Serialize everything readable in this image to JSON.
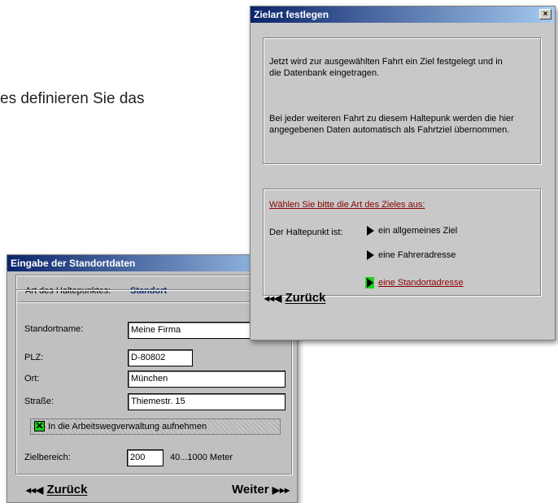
{
  "background_text": "es definieren Sie das",
  "standort_dialog": {
    "title": "Eingabe der Standortdaten",
    "type_label": "Art des Haltepunktes:",
    "type_value": "Standort",
    "name_label": "Standortname:",
    "name_value": "Meine Firma",
    "plz_label": "PLZ:",
    "plz_value": "D-80802",
    "ort_label": "Ort:",
    "ort_value": "München",
    "strasse_label": "Straße:",
    "strasse_value": "Thiemestr. 15",
    "checkbox_label": "In die Arbeitswegverwaltung aufnehmen",
    "checkbox_checked": true,
    "zielbereich_label": "Zielbereich:",
    "zielbereich_value": "200",
    "zielbereich_range": "40...1000 Meter",
    "back_label": "Zurück",
    "next_label": "Weiter"
  },
  "zielart_dialog": {
    "title": "Zielart festlegen",
    "close_glyph": "×",
    "info_line1": "Jetzt wird zur ausgewählten Fahrt ein Ziel festgelegt und in",
    "info_line2": "die Datenbank eingetragen.",
    "info_line3": "Bei jeder weiteren Fahrt zu diesem Haltepunk werden die hier",
    "info_line4": "angegebenen Daten automatisch als Fahrtziel übernommen.",
    "prompt": "Wählen Sie bitte die Art des Zieles aus:",
    "haltepunkt_label": "Der Haltepunkt ist:",
    "options": [
      "ein allgemeines Ziel",
      "eine Fahreradresse",
      "eine Standortadresse"
    ],
    "selected_option": 2,
    "back_label": "Zurück"
  },
  "colors": {
    "titlebar_start": "#0a246a",
    "titlebar_end": "#a6caf0",
    "window_bg": "#c0c0c0",
    "prompt_red": "#8b0000",
    "type_value_blue": "#0a246a",
    "checkbox_green": "#1cd11c"
  }
}
